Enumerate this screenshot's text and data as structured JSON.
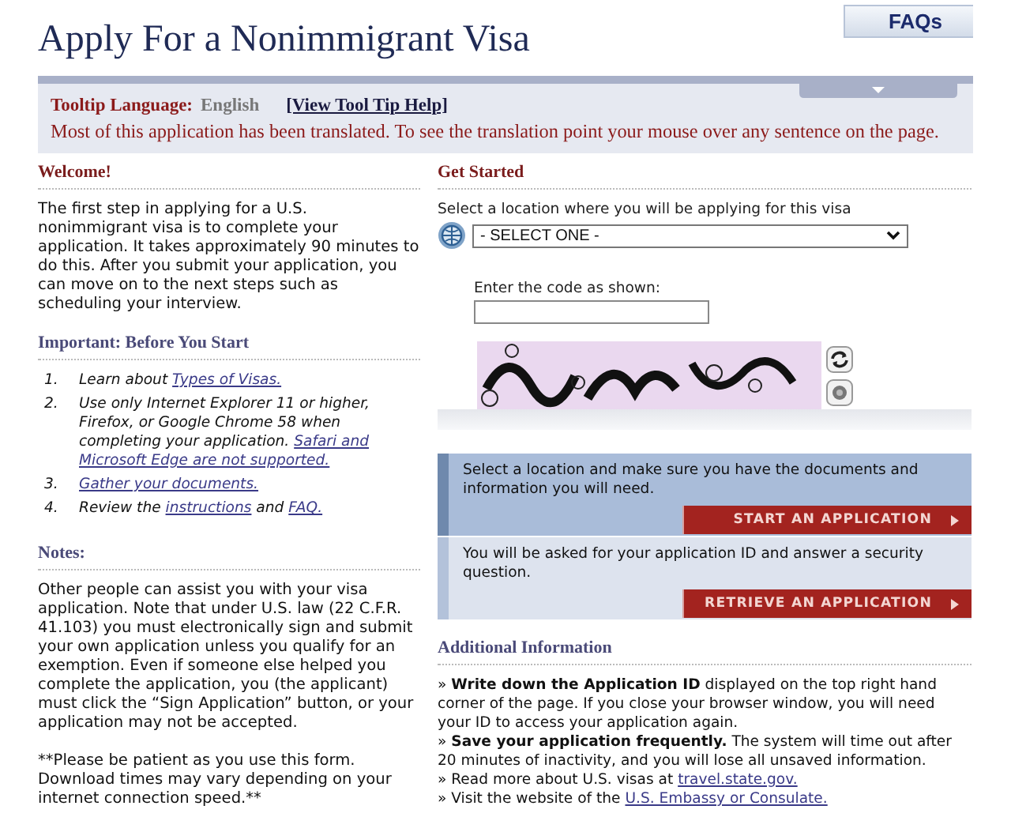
{
  "header": {
    "title": "Apply For a Nonimmigrant Visa",
    "faq_button": "FAQs"
  },
  "banner": {
    "language_label": "Tooltip Language:",
    "language": "English",
    "help_link": "[View Tool Tip Help]",
    "message": "Most of this application has been translated. To see the translation point your mouse over any sentence on the page."
  },
  "left_column": [
    {
      "heading": "Welcome!",
      "kind": "primary",
      "paragraphs": [
        "The first step in applying for a U.S. nonimmigrant visa is to complete your application. It takes approximately 90 minutes to do this. After you submit your application, you can move on to the next steps such as scheduling your interview."
      ]
    },
    {
      "heading": "Important: Before You Start",
      "kind": "secondary",
      "steps": [
        {
          "number": "1.",
          "parts": [
            {
              "text": "Learn about "
            },
            {
              "link": "Types of Visas."
            }
          ]
        },
        {
          "number": "2.",
          "parts": [
            {
              "text": "Use only Internet Explorer 11 or higher, Firefox, or Google Chrome 58 when completing your application. "
            },
            {
              "link": "Safari and"
            },
            {
              "link": "Microsoft Edge are not supported."
            }
          ]
        },
        {
          "number": "3.",
          "parts": [
            {
              "link": "Gather your documents."
            }
          ]
        },
        {
          "number": "4.",
          "parts": [
            {
              "text": "Review the "
            },
            {
              "link": "instructions"
            },
            {
              "text": " and "
            },
            {
              "link": "FAQ."
            }
          ]
        }
      ]
    },
    {
      "heading": "Notes:",
      "kind": "secondary",
      "paragraphs": [
        "Other people can assist you with your visa application. Note that under U.S. law (22 C.F.R. 41.103) you must electronically sign and submit your own application unless you qualify for an exemption. Even if someone else helped you complete the application, you (the applicant) must click the “Sign Application” button, or your application may not be accepted.",
        "**Please be patient as you use this form. Download times may vary depending on your internet connection speed.**"
      ]
    }
  ],
  "get_started": {
    "heading": "Get Started",
    "kind": "primary",
    "location_label": "Select a location where you will be applying for this visa",
    "location_select": "- SELECT ONE -",
    "code_label": "Enter the code as shown:",
    "actions": [
      {
        "kind": "primary",
        "text": "Select a location and make sure you have the documents and information you will need.",
        "button": "START AN APPLICATION"
      },
      {
        "kind": "secondary",
        "text": "You will be asked for your application ID and answer a security question.",
        "button": "RETRIEVE AN APPLICATION"
      }
    ]
  },
  "additional_information": {
    "heading": "Additional Information",
    "kind": "secondary",
    "items": [
      {
        "text": "» **Write down the Application ID** displayed on the top right hand corner of the page. If you close your browser window, you will need your ID to access your application again."
      },
      {
        "text": "» **Save your application frequently.** The system will time out after 20 minutes of inactivity, and you will lose all unsaved information."
      },
      {
        "text": "» Read more about U.S. visas at ",
        "link": "travel.state.gov."
      },
      {
        "text": "» Visit the website of the ",
        "link": "U.S. Embassy or Consulate."
      }
    ]
  }
}
